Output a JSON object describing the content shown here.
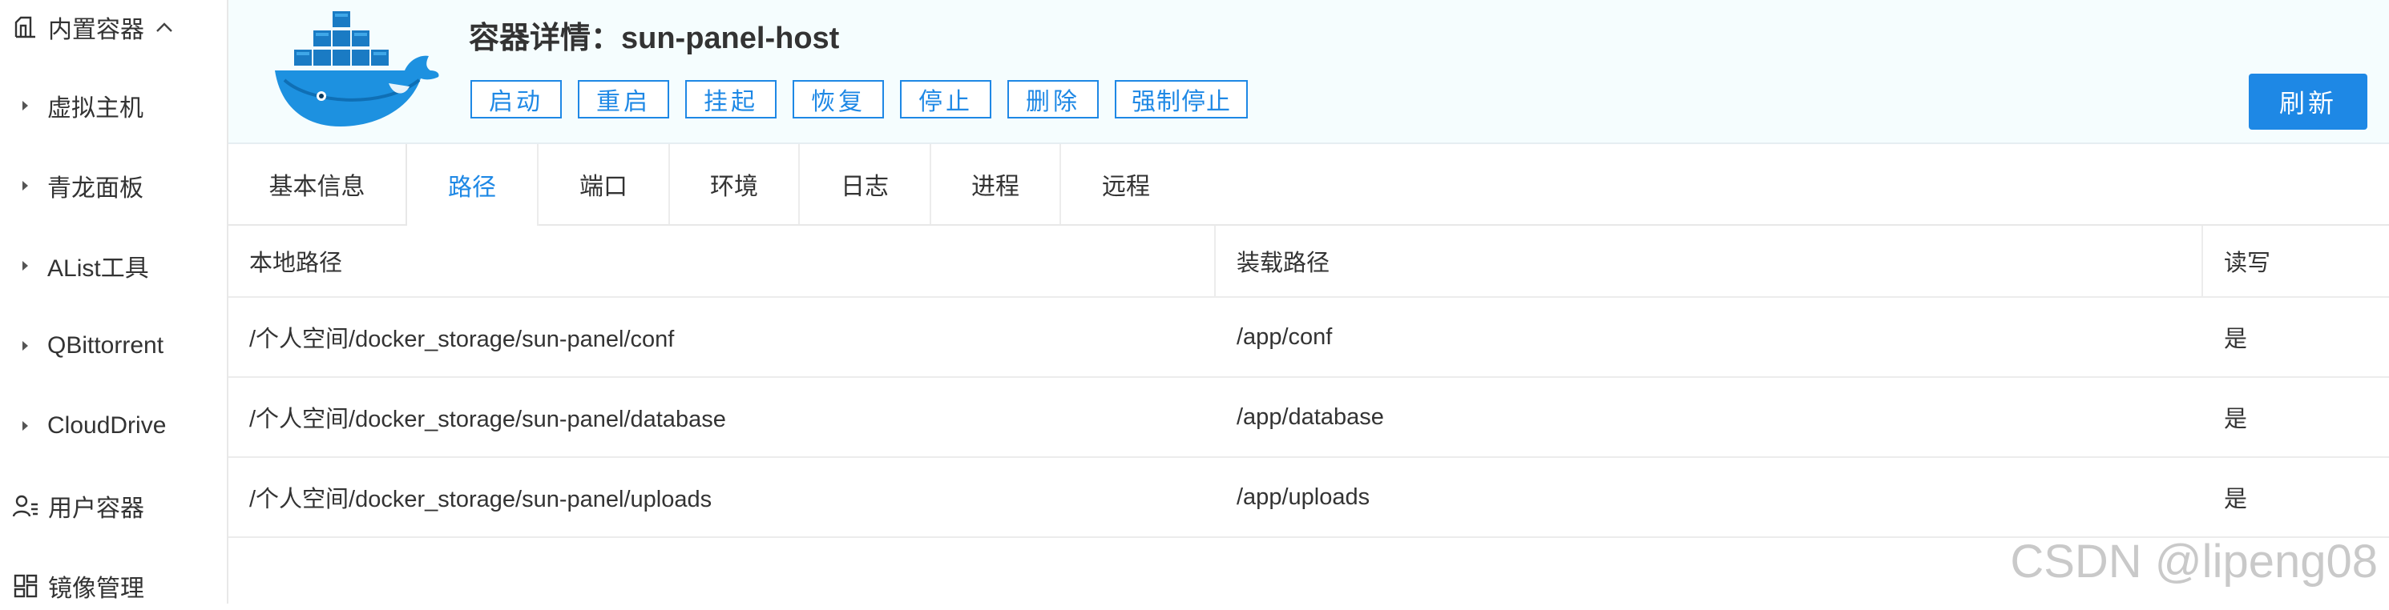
{
  "sidebar": {
    "group": {
      "label": "内置容器",
      "icon": "container-icon",
      "expanded": true
    },
    "items": [
      {
        "label": "虚拟主机"
      },
      {
        "label": "青龙面板"
      },
      {
        "label": "AList工具"
      },
      {
        "label": "QBittorrent"
      },
      {
        "label": "CloudDrive"
      }
    ],
    "user_containers": {
      "label": "用户容器",
      "icon": "user-icon"
    },
    "image_management": {
      "label": "镜像管理",
      "icon": "grid-icon"
    }
  },
  "header": {
    "title": "容器详情：sun-panel-host",
    "logo": "docker-logo-icon",
    "actions": [
      "启动",
      "重启",
      "挂起",
      "恢复",
      "停止",
      "删除",
      "强制停止"
    ],
    "refresh_label": "刷新"
  },
  "tabs": [
    {
      "label": "基本信息"
    },
    {
      "label": "路径",
      "active": true
    },
    {
      "label": "端口"
    },
    {
      "label": "环境"
    },
    {
      "label": "日志"
    },
    {
      "label": "进程"
    },
    {
      "label": "远程"
    }
  ],
  "table": {
    "columns": [
      "本地路径",
      "装载路径",
      "读写"
    ],
    "rows": [
      [
        "/个人空间/docker_storage/sun-panel/conf",
        "/app/conf",
        "是"
      ],
      [
        "/个人空间/docker_storage/sun-panel/database",
        "/app/database",
        "是"
      ],
      [
        "/个人空间/docker_storage/sun-panel/uploads",
        "/app/uploads",
        "是"
      ]
    ]
  },
  "watermark": "CSDN @lipeng08",
  "colors": {
    "accent": "#1e88e5",
    "header_bg": "#f5fdfe",
    "docker_blue": "#1d91e0"
  }
}
